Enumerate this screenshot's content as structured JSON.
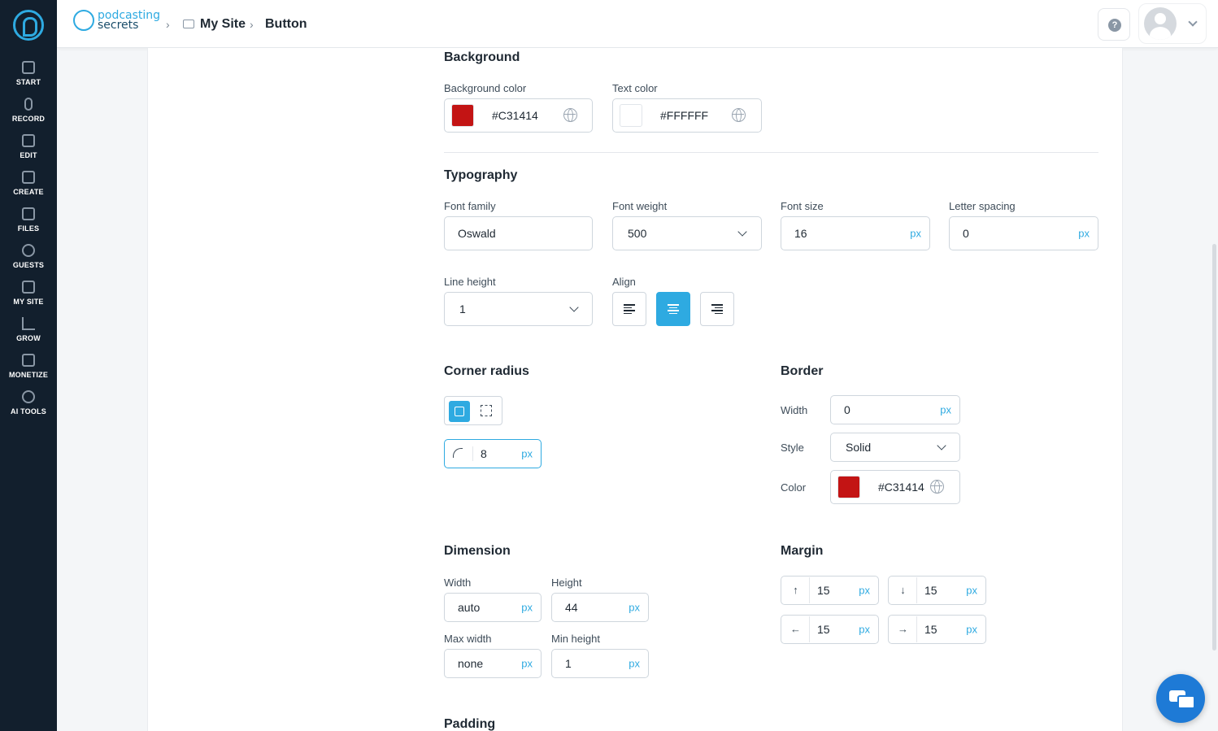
{
  "sidebar": {
    "items": [
      {
        "label": "START",
        "icon": "start-icon"
      },
      {
        "label": "RECORD",
        "icon": "mic-icon"
      },
      {
        "label": "EDIT",
        "icon": "edit-icon"
      },
      {
        "label": "CREATE",
        "icon": "create-icon"
      },
      {
        "label": "FILES",
        "icon": "files-icon"
      },
      {
        "label": "GUESTS",
        "icon": "guests-icon"
      },
      {
        "label": "MY SITE",
        "icon": "site-icon"
      },
      {
        "label": "GROW",
        "icon": "chart-icon"
      },
      {
        "label": "MONETIZE",
        "icon": "money-icon"
      },
      {
        "label": "AI TOOLS",
        "icon": "ai-icon"
      }
    ]
  },
  "header": {
    "brand_line1": "podcasting",
    "brand_line2": "secrets",
    "breadcrumb": [
      "My Site",
      "Button"
    ]
  },
  "background": {
    "title": "Background",
    "bg_color_label": "Background color",
    "bg_color_value": "#C31414",
    "text_color_label": "Text color",
    "text_color_value": "#FFFFFF"
  },
  "typography": {
    "title": "Typography",
    "font_family_label": "Font family",
    "font_family_value": "Oswald",
    "font_weight_label": "Font weight",
    "font_weight_value": "500",
    "font_size_label": "Font size",
    "font_size_value": "16",
    "letter_spacing_label": "Letter spacing",
    "letter_spacing_value": "0",
    "line_height_label": "Line height",
    "line_height_value": "1",
    "align_label": "Align",
    "align_selected": "center",
    "unit": "px"
  },
  "corner_radius": {
    "title": "Corner radius",
    "value": "8",
    "unit": "px"
  },
  "border": {
    "title": "Border",
    "width_label": "Width",
    "width_value": "0",
    "style_label": "Style",
    "style_value": "Solid",
    "color_label": "Color",
    "color_value": "#C31414",
    "unit": "px"
  },
  "dimension": {
    "title": "Dimension",
    "width_label": "Width",
    "width_value": "auto",
    "height_label": "Height",
    "height_value": "44",
    "max_width_label": "Max width",
    "max_width_value": "none",
    "min_height_label": "Min height",
    "min_height_value": "1",
    "unit": "px"
  },
  "margin": {
    "title": "Margin",
    "top": "15",
    "bottom": "15",
    "left": "15",
    "right": "15",
    "unit": "px"
  },
  "padding": {
    "title": "Padding"
  },
  "colors": {
    "accent": "#2EAAE1",
    "sidebar_bg": "#121F2D",
    "swatch_red": "#C31414"
  }
}
